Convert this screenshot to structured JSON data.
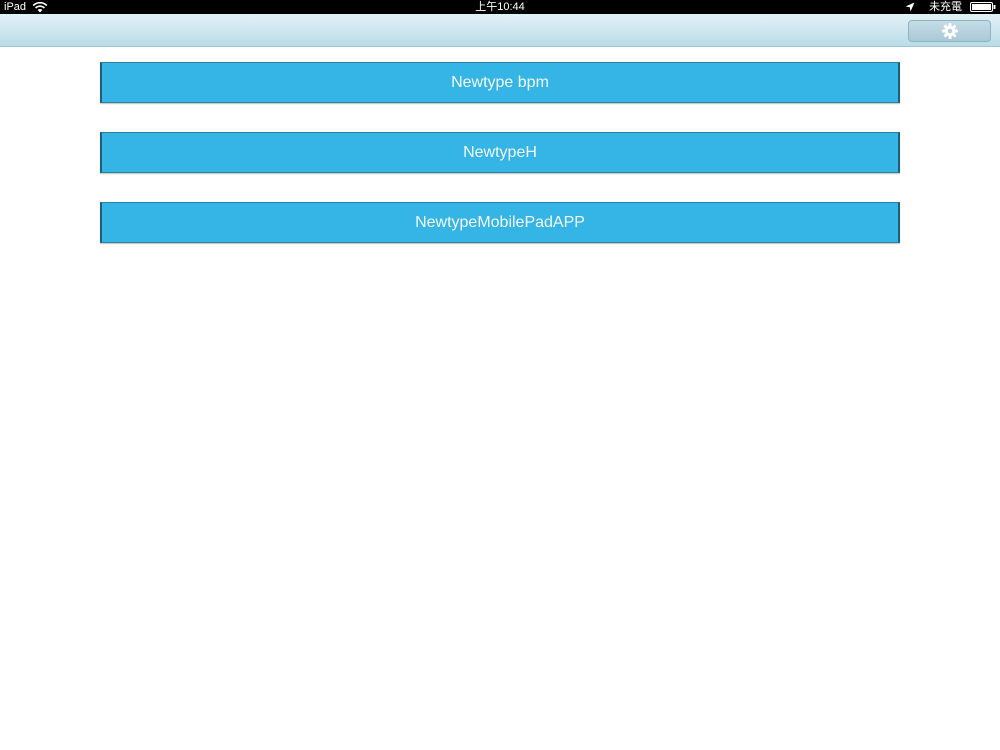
{
  "status_bar": {
    "device": "iPad",
    "time": "上午10:44",
    "charge_status": "未充電",
    "icons": [
      "wifi-icon",
      "location-icon",
      "battery-icon"
    ]
  },
  "nav_bar": {
    "settings_icon": "gear-icon"
  },
  "apps": [
    {
      "label": "Newtype bpm"
    },
    {
      "label": "NewtypeH"
    },
    {
      "label": "NewtypeMobilePadAPP"
    }
  ],
  "colors": {
    "button_fill": "#35b4e6",
    "button_text": "#f3fbff",
    "nav_bar": "#cfe7f0",
    "status_bar": "#000000"
  }
}
